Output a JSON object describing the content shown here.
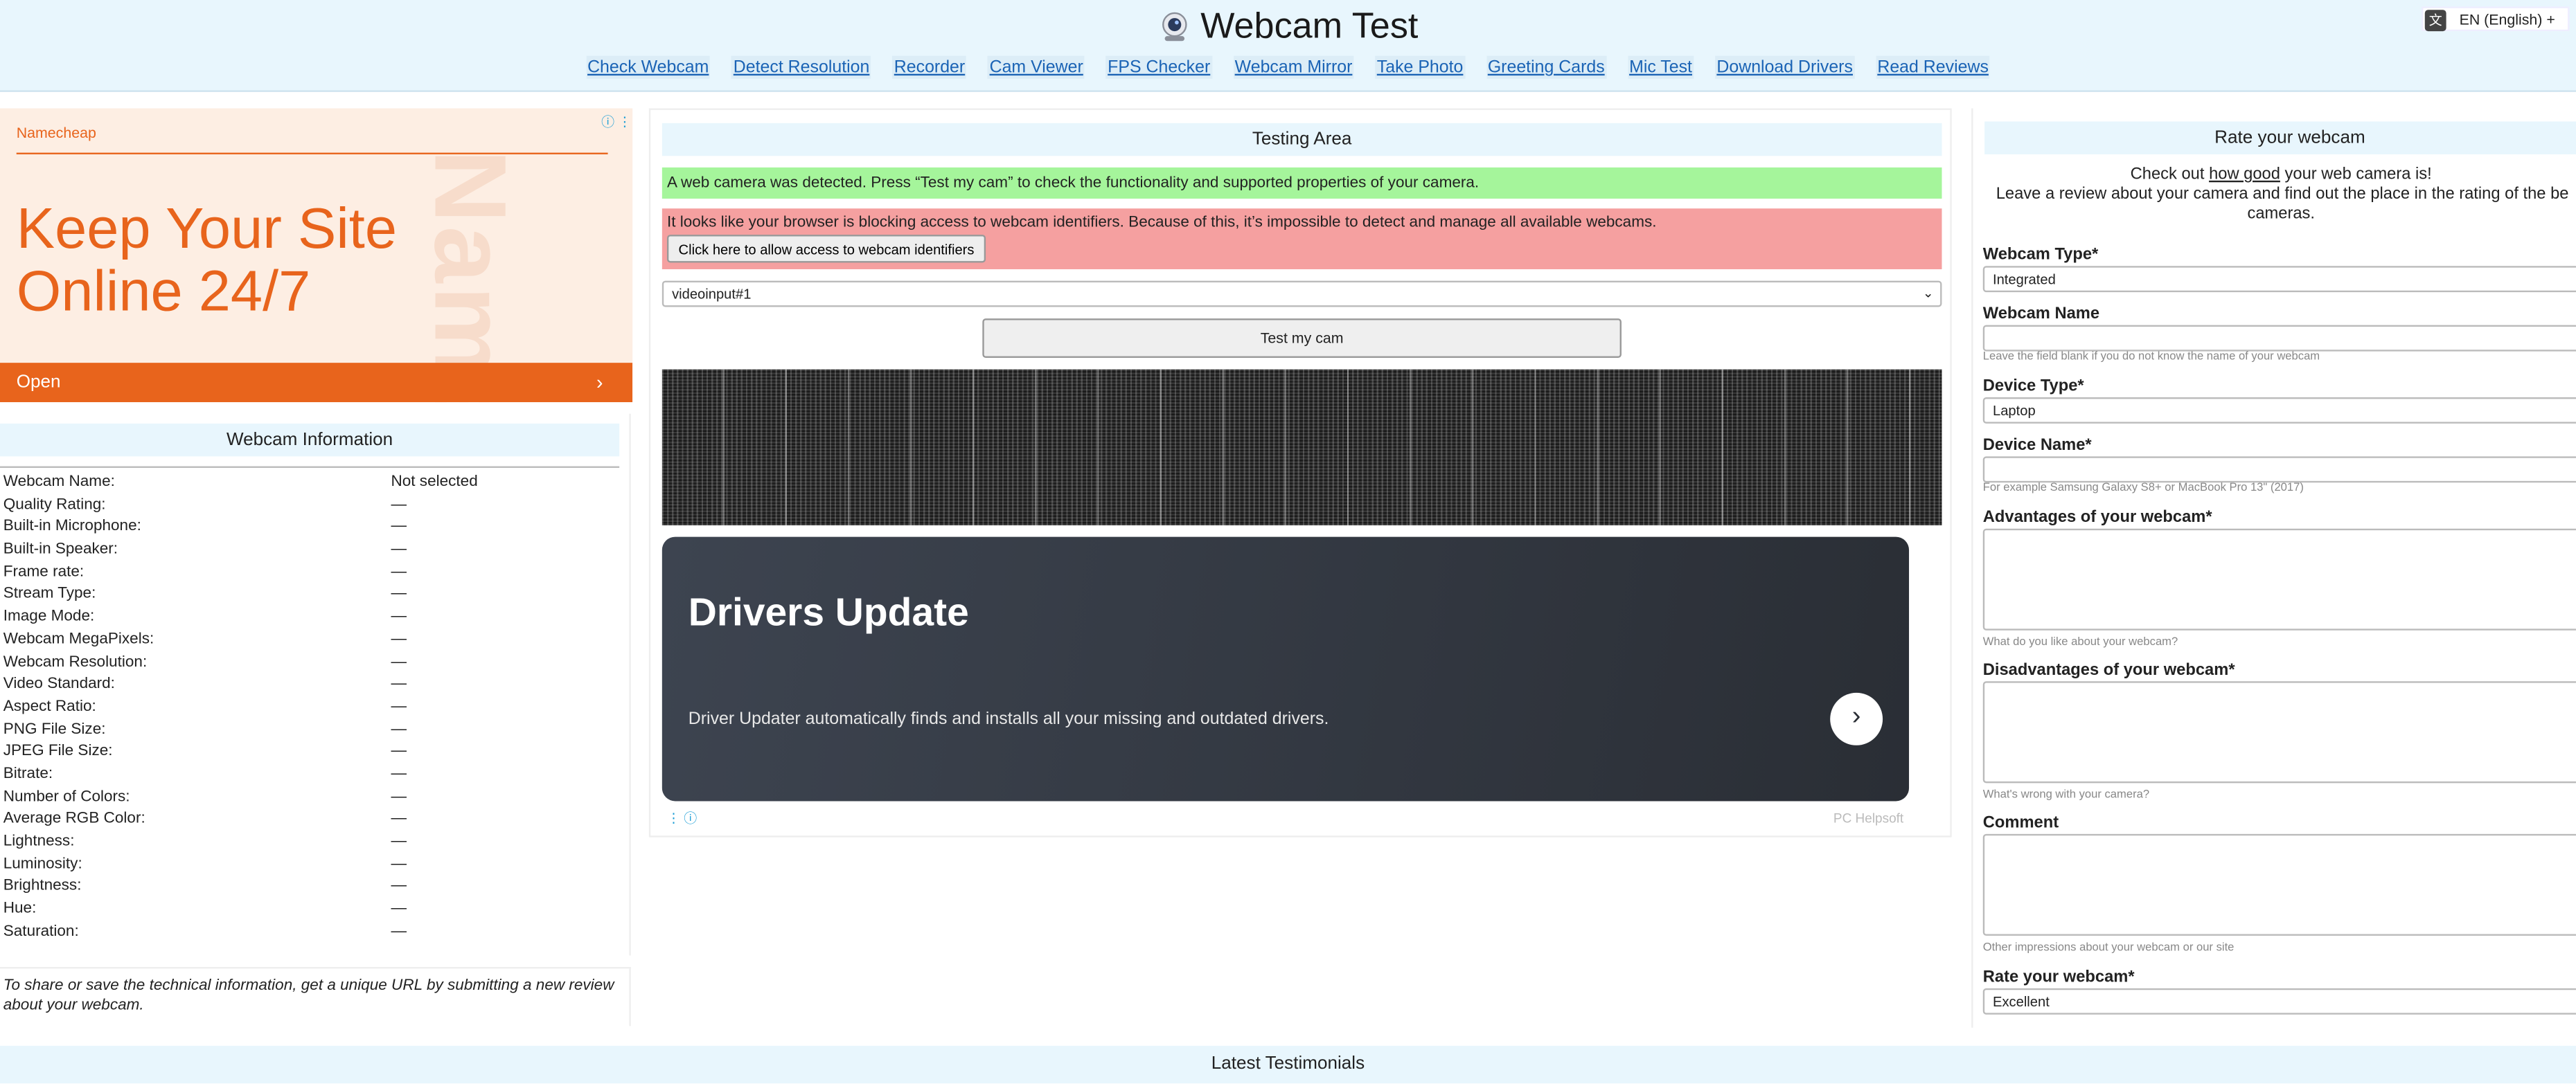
{
  "header": {
    "title": "Webcam Test",
    "language": "EN (English) +",
    "nav": [
      "Check Webcam",
      "Detect Resolution",
      "Recorder",
      "Cam Viewer",
      "FPS Checker",
      "Webcam Mirror",
      "Take Photo",
      "Greeting Cards",
      "Mic Test",
      "Download Drivers",
      "Read Reviews"
    ]
  },
  "ad_left": {
    "brand": "Namecheap",
    "headline": "Keep Your Site Online 24/7",
    "watermark": "Namecheap",
    "button": "Open"
  },
  "info": {
    "title": "Webcam Information",
    "rows": [
      {
        "k": "Webcam Name:",
        "v": "Not selected"
      },
      {
        "k": "Quality Rating:",
        "v": "—"
      },
      {
        "k": "Built-in Microphone:",
        "v": "—"
      },
      {
        "k": "Built-in Speaker:",
        "v": "—"
      },
      {
        "k": "Frame rate:",
        "v": "—"
      },
      {
        "k": "Stream Type:",
        "v": "—"
      },
      {
        "k": "Image Mode:",
        "v": "—"
      },
      {
        "k": "Webcam MegaPixels:",
        "v": "—"
      },
      {
        "k": "Webcam Resolution:",
        "v": "—"
      },
      {
        "k": "Video Standard:",
        "v": "—"
      },
      {
        "k": "Aspect Ratio:",
        "v": "—"
      },
      {
        "k": "PNG File Size:",
        "v": "—"
      },
      {
        "k": "JPEG File Size:",
        "v": "—"
      },
      {
        "k": "Bitrate:",
        "v": "—"
      },
      {
        "k": "Number of Colors:",
        "v": "—"
      },
      {
        "k": "Average RGB Color:",
        "v": "—"
      },
      {
        "k": "Lightness:",
        "v": "—"
      },
      {
        "k": "Luminosity:",
        "v": "—"
      },
      {
        "k": "Brightness:",
        "v": "—"
      },
      {
        "k": "Hue:",
        "v": "—"
      },
      {
        "k": "Saturation:",
        "v": "—"
      }
    ],
    "share_note": "To share or save the technical information, get a unique URL by submitting a new review about your webcam."
  },
  "testing": {
    "title": "Testing Area",
    "detected": "A web camera was detected. Press “Test my cam” to check the functionality and supported properties of your camera.",
    "blocked": "It looks like your browser is blocking access to webcam identifiers. Because of this, it’s impossible to detect and manage all available webcams.",
    "allow_button": "Click here to allow access to webcam identifiers",
    "device_select": "videoinput#1",
    "test_button": "Test my cam"
  },
  "ad_center": {
    "title": "Drivers Update",
    "description": "Driver Updater automatically finds and installs all your missing and outdated drivers.",
    "source": "PC Helpsoft",
    "adchoices": "⋮ ⓘ"
  },
  "rate": {
    "title": "Rate your webcam",
    "intro_a": "Check out ",
    "intro_link": "how good",
    "intro_b": " your web camera is!",
    "intro2": "Leave a review about your camera and find out the place in the rating of the be",
    "intro3": "cameras.",
    "webcam_type_label": "Webcam Type*",
    "webcam_type_value": "Integrated",
    "webcam_name_label": "Webcam Name",
    "webcam_name_hint": "Leave the field blank if you do not know the name of your webcam",
    "device_type_label": "Device Type*",
    "device_type_value": "Laptop",
    "device_name_label": "Device Name*",
    "device_name_hint": "For example Samsung Galaxy S8+ or MacBook Pro 13\" (2017)",
    "advantages_label": "Advantages of your webcam*",
    "advantages_hint": "What do you like about your webcam?",
    "disadvantages_label": "Disadvantages of your webcam*",
    "disadvantages_hint": "What's wrong with your camera?",
    "comment_label": "Comment",
    "comment_hint": "Other impressions about your webcam or our site",
    "rating_label": "Rate your webcam*",
    "rating_value": "Excellent"
  },
  "footer": {
    "title": "Latest Testimonials"
  },
  "colors": {
    "accent_orange": "#e8641c",
    "link_blue": "#1a63b5",
    "panel_blue": "#e8f6fd",
    "success_green": "#a5f59b",
    "error_red": "#f5a0a0"
  }
}
